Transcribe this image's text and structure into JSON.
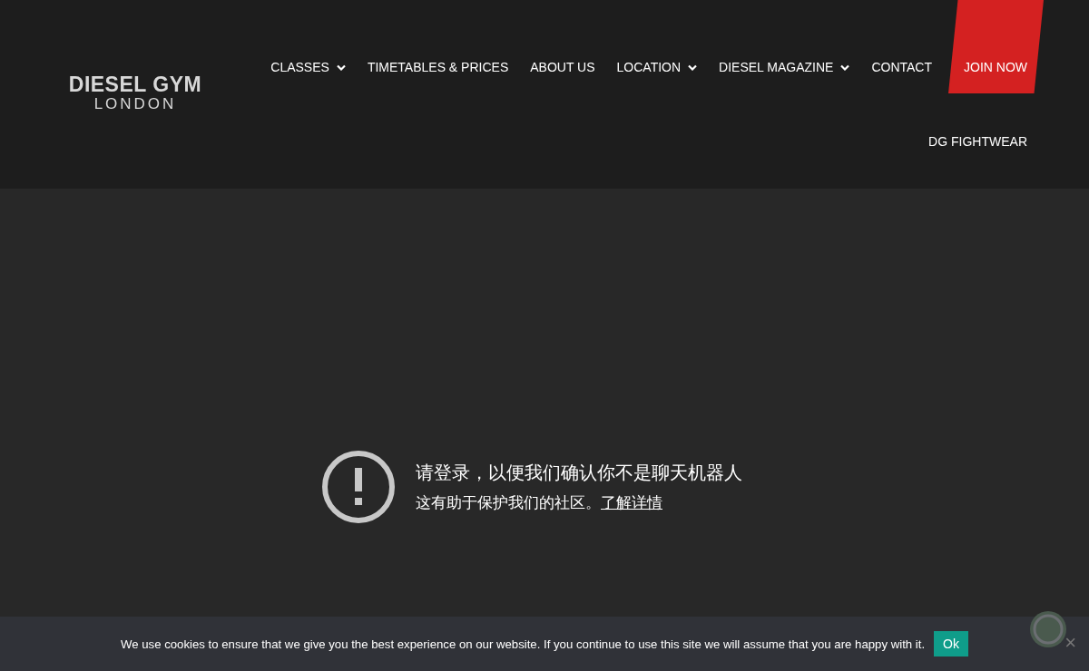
{
  "logo": {
    "line_1": "DIESEL GYM",
    "line_2": "LONDON"
  },
  "nav": [
    {
      "label": "CLASSES",
      "dropdown": true,
      "kind": "link"
    },
    {
      "label": "TIMETABLES & PRICES",
      "dropdown": false,
      "kind": "link"
    },
    {
      "label": "ABOUT US",
      "dropdown": false,
      "kind": "link"
    },
    {
      "label": "LOCATION",
      "dropdown": true,
      "kind": "link"
    },
    {
      "label": "DIESEL MAGAZINE",
      "dropdown": true,
      "kind": "link"
    },
    {
      "label": "CONTACT",
      "dropdown": false,
      "kind": "link"
    },
    {
      "label": "JOIN NOW",
      "kind": "highlight"
    }
  ],
  "nav_row_2": [
    {
      "label": "DG FIGHTWEAR"
    }
  ],
  "notice": {
    "title": "请登录，以便我们确认你不是聊天机器人",
    "text": "这有助于保护我们的社区。",
    "link": "了解详情"
  },
  "cookie_bar": {
    "text": "We use cookies to ensure that we give you the best experience on our website. If you continue to use this site we will assume that you are happy with it.",
    "button": "Ok",
    "close": "×"
  }
}
